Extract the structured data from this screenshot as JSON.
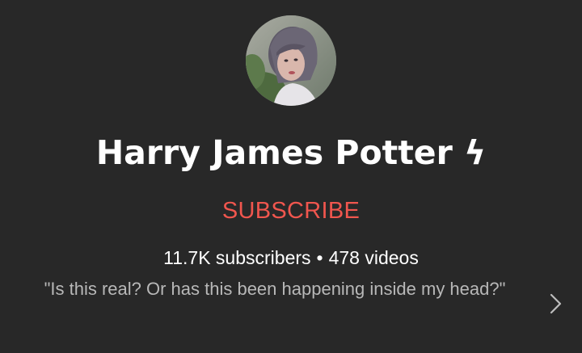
{
  "channel": {
    "name": "Harry James Potter ϟ",
    "subscribe_label": "SUBSCRIBE",
    "subscribers": "11.7K subscribers",
    "separator": "•",
    "videos": "478 videos",
    "description": "\"Is this real? Or has this been happening inside my head?\""
  },
  "colors": {
    "background": "#282828",
    "subscribe": "#f0564e",
    "text": "#ffffff",
    "description": "#b8b8b8"
  },
  "icons": {
    "avatar": "profile-photo",
    "more": "chevron-right-icon"
  }
}
